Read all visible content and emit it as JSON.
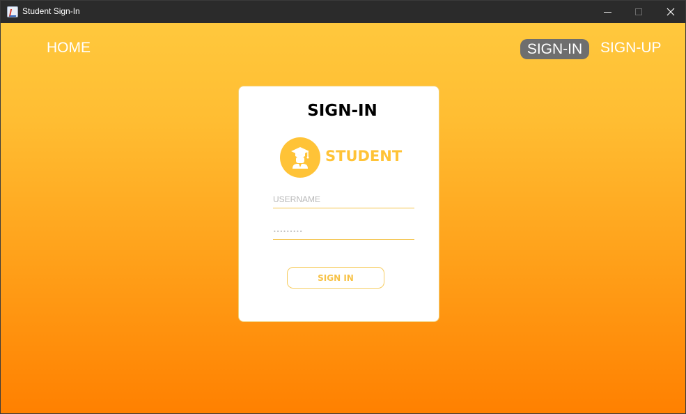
{
  "window": {
    "title": "Student Sign-In",
    "icon": "java-app-icon",
    "controls": {
      "minimize": "minimize-icon",
      "maximize": "maximize-icon",
      "close": "close-icon"
    }
  },
  "nav": {
    "home": "HOME",
    "signin": "SIGN-IN",
    "signup": "SIGN-UP",
    "active": "SIGN-IN"
  },
  "card": {
    "title": "SIGN-IN",
    "role_icon": "graduate-student-icon",
    "role_label": "STUDENT",
    "username": {
      "placeholder": "USERNAME",
      "value": ""
    },
    "password": {
      "placeholder": "",
      "value": "•••••••••"
    },
    "submit_label": "SIGN IN"
  },
  "colors": {
    "accent": "#ffc337",
    "gradient_top": "#ffc83d",
    "gradient_bottom": "#ff8000",
    "nav_active_bg": "#6e6e6e",
    "titlebar": "#2b2b2b"
  }
}
